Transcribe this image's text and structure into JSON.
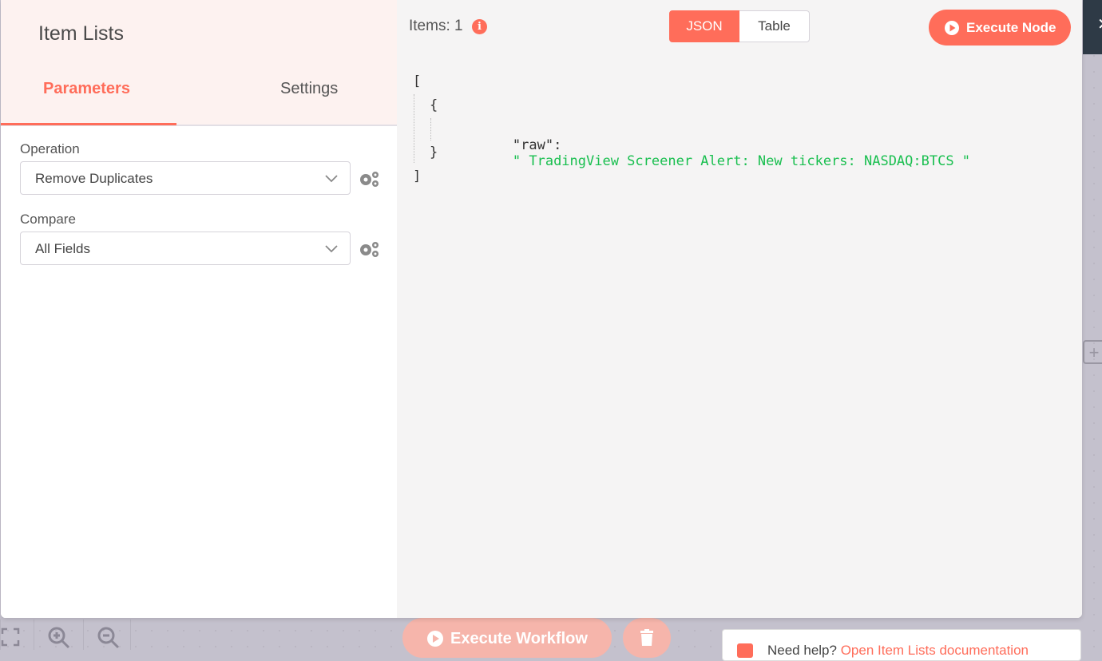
{
  "node": {
    "title": "Item Lists"
  },
  "tabs": {
    "parameters": "Parameters",
    "settings": "Settings"
  },
  "fields": [
    {
      "label": "Operation",
      "value": "Remove Duplicates"
    },
    {
      "label": "Compare",
      "value": "All Fields"
    }
  ],
  "output": {
    "items_label": "Items: 1",
    "info_glyph": "i",
    "view_json": "JSON",
    "view_table": "Table",
    "execute_node": "Execute Node",
    "json_lines": [
      "[",
      "{",
      "\"raw\":",
      "\" TradingView Screener Alert: New tickers: NASDAQ:BTCS \"",
      "}",
      "]"
    ]
  },
  "canvas": {
    "execute_workflow": "Execute Workflow",
    "help_prefix": "Need help?",
    "help_link": "Open Item Lists documentation"
  },
  "colors": {
    "accent": "#ff6d5a",
    "json_string": "#19bf4f"
  },
  "icons": [
    "gear-icon",
    "play-icon",
    "info-icon",
    "chevron-down-icon",
    "zoom-in-icon",
    "zoom-out-icon",
    "fullscreen-icon",
    "trash-icon",
    "close-icon",
    "add-node-icon"
  ]
}
